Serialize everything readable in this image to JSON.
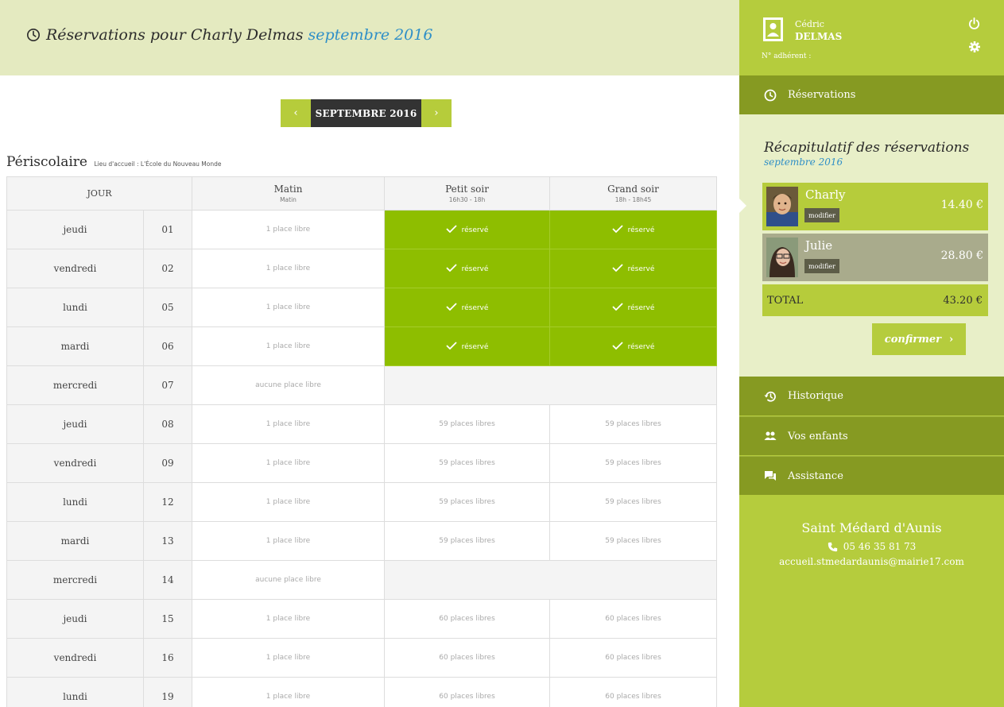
{
  "header": {
    "title": "Réservations pour Charly Delmas",
    "month": "septembre 2016"
  },
  "month_nav": {
    "prev": "‹",
    "current": "SEPTEMBRE 2016",
    "next": "›"
  },
  "section": {
    "title": "Périscolaire",
    "place": "Lieu d'accueil : L'École du Nouveau Monde"
  },
  "table": {
    "headers": [
      {
        "label": "JOUR",
        "sub": ""
      },
      {
        "label": "Matin",
        "sub": "Matin"
      },
      {
        "label": "Petit soir",
        "sub": "16h30 - 18h"
      },
      {
        "label": "Grand soir",
        "sub": "18h - 18h45"
      }
    ],
    "rows": [
      {
        "day": "jeudi",
        "num": "01",
        "matin": "1 place libre",
        "petit": "réservé",
        "grand": "réservé",
        "status": "reserved"
      },
      {
        "day": "vendredi",
        "num": "02",
        "matin": "1 place libre",
        "petit": "réservé",
        "grand": "réservé",
        "status": "reserved"
      },
      {
        "day": "lundi",
        "num": "05",
        "matin": "1 place libre",
        "petit": "réservé",
        "grand": "réservé",
        "status": "reserved"
      },
      {
        "day": "mardi",
        "num": "06",
        "matin": "1 place libre",
        "petit": "réservé",
        "grand": "réservé",
        "status": "reserved"
      },
      {
        "day": "mercredi",
        "num": "07",
        "matin": "aucune place libre",
        "petit": "",
        "grand": "",
        "status": "blocked"
      },
      {
        "day": "jeudi",
        "num": "08",
        "matin": "1 place libre",
        "petit": "59 places libres",
        "grand": "59 places libres",
        "status": "free"
      },
      {
        "day": "vendredi",
        "num": "09",
        "matin": "1 place libre",
        "petit": "59 places libres",
        "grand": "59 places libres",
        "status": "free"
      },
      {
        "day": "lundi",
        "num": "12",
        "matin": "1 place libre",
        "petit": "59 places libres",
        "grand": "59 places libres",
        "status": "free"
      },
      {
        "day": "mardi",
        "num": "13",
        "matin": "1 place libre",
        "petit": "59 places libres",
        "grand": "59 places libres",
        "status": "free"
      },
      {
        "day": "mercredi",
        "num": "14",
        "matin": "aucune place libre",
        "petit": "",
        "grand": "",
        "status": "blocked"
      },
      {
        "day": "jeudi",
        "num": "15",
        "matin": "1 place libre",
        "petit": "60 places libres",
        "grand": "60 places libres",
        "status": "free"
      },
      {
        "day": "vendredi",
        "num": "16",
        "matin": "1 place libre",
        "petit": "60 places libres",
        "grand": "60 places libres",
        "status": "free"
      },
      {
        "day": "lundi",
        "num": "19",
        "matin": "1 place libre",
        "petit": "60 places libres",
        "grand": "60 places libres",
        "status": "free"
      }
    ]
  },
  "user": {
    "first_name": "Cédric",
    "last_name": "DELMAS",
    "member_label": "N° adhérent :"
  },
  "menu": {
    "reservations": "Réservations",
    "historique": "Historique",
    "enfants": "Vos enfants",
    "assistance": "Assistance"
  },
  "recap": {
    "title": "Récapitulatif des réservations",
    "month": "septembre 2016",
    "children": [
      {
        "name": "Charly",
        "modify": "modifier",
        "amount": "14.40 €"
      },
      {
        "name": "Julie",
        "modify": "modifier",
        "amount": "28.80 €"
      }
    ],
    "total_label": "TOTAL",
    "total_amount": "43.20 €",
    "confirm": "confirmer"
  },
  "contact": {
    "name": "Saint Médard d'Aunis",
    "phone": "05 46 35 81 73",
    "email": "accueil.stmedardaunis@mairie17.com"
  },
  "colors": {
    "accent": "#b5cc3d",
    "reserved": "#8ebe00",
    "menu": "#869a22",
    "header_bg": "#e4eac0",
    "month_blue": "#2f8fc7"
  },
  "icons": [
    "clock-icon",
    "user-card-icon",
    "power-icon",
    "gear-icon",
    "history-icon",
    "children-icon",
    "chat-icon",
    "phone-icon",
    "check-icon"
  ]
}
